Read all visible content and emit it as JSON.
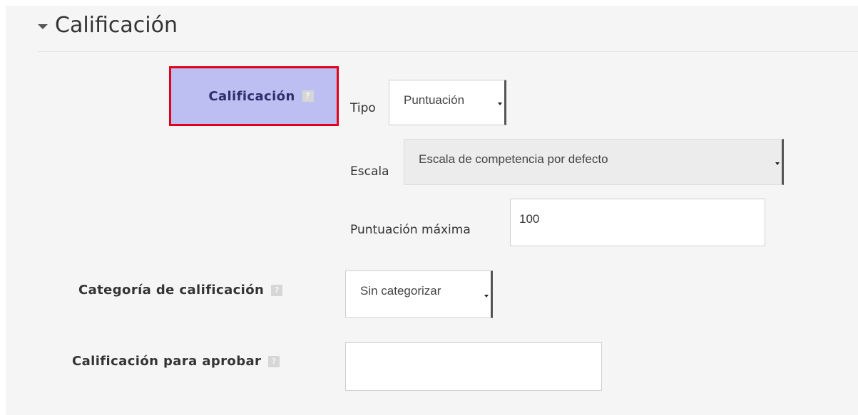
{
  "section": {
    "title": "Calificación"
  },
  "fields": {
    "grade": {
      "label": "Calificación",
      "help_icon": "help-icon",
      "type_label": "Tipo",
      "type_value": "Puntuación",
      "scale_label": "Escala",
      "scale_value": "Escala de competencia por defecto",
      "max_points_label": "Puntuación máxima",
      "max_points_value": "100"
    },
    "grade_category": {
      "label": "Categoría de calificación",
      "value": "Sin categorizar"
    },
    "grade_to_pass": {
      "label": "Calificación para aprobar",
      "value": ""
    }
  },
  "colors": {
    "highlight_fill": "#bdbff2",
    "highlight_border": "#e3001b",
    "panel_background": "#f5f5f5"
  }
}
